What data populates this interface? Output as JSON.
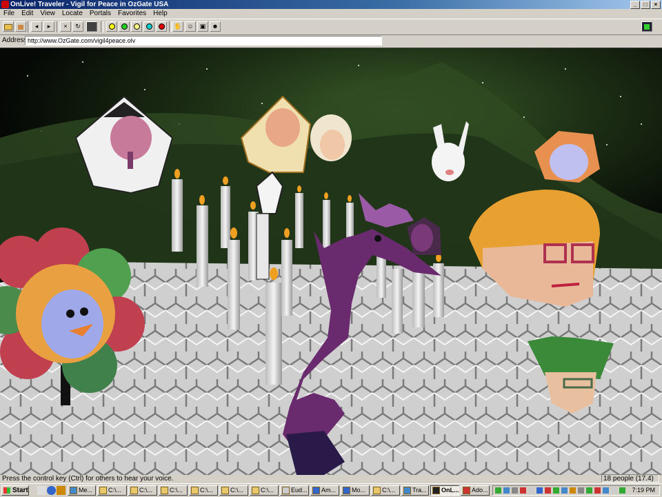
{
  "window": {
    "title": "OnLive! Traveler - Vigil for Peace in OzGate USA",
    "controls": [
      "_",
      "□",
      "×"
    ]
  },
  "menu": [
    "File",
    "Edit",
    "View",
    "Locate",
    "Portals",
    "Favorites",
    "Help"
  ],
  "address": {
    "label": "Address:",
    "value": "http://www.OzGate.com/vigil4peace.olv"
  },
  "status": {
    "message": "Press the control key (Ctrl) for others to hear your voice.",
    "people": "18 people (17.4)"
  },
  "taskbar": {
    "start": "Start",
    "tasks": [
      {
        "label": "Me..."
      },
      {
        "label": "C:\\..."
      },
      {
        "label": "C:\\..."
      },
      {
        "label": "C:\\..."
      },
      {
        "label": "C:\\..."
      },
      {
        "label": "C:\\..."
      },
      {
        "label": "C:\\..."
      },
      {
        "label": "Eud..."
      },
      {
        "label": "Am..."
      },
      {
        "label": "Mo..."
      },
      {
        "label": "C:\\..."
      },
      {
        "label": "Tra..."
      },
      {
        "label": "OnL..."
      },
      {
        "label": "Ado..."
      }
    ],
    "clock": "7:19 PM"
  },
  "colors": {
    "title_bar": "#0a246a",
    "chrome": "#d4d0c8",
    "floor": "#d8d8d8",
    "sky": "#1a2a10",
    "seahorse": "#6a2a6e",
    "glasses_face_hair": "#e8a030"
  }
}
